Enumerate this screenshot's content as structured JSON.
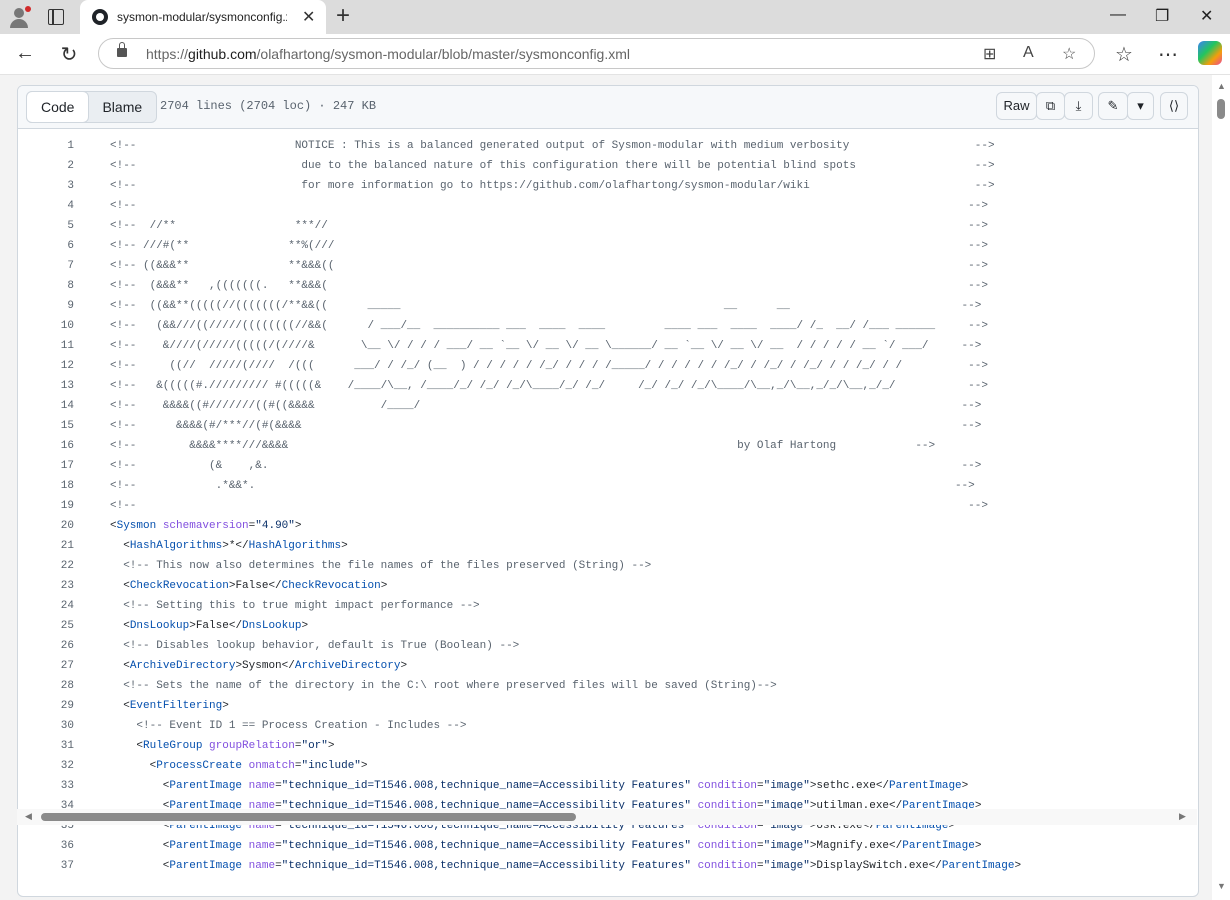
{
  "browser": {
    "tab_title": "sysmon-modular/sysmonconfig.xml",
    "url_prefix": "https://",
    "url_host": "github.com",
    "url_path": "/olafhartong/sysmon-modular/blob/master/sysmonconfig.xml"
  },
  "toolbar": {
    "code_label": "Code",
    "blame_label": "Blame",
    "file_info": "2704 lines (2704 loc) · 247 KB",
    "raw_label": "Raw"
  },
  "code_lines": [
    {
      "n": "1",
      "t": "<!--                        NOTICE : This is a balanced generated output of Sysmon-modular with medium verbosity                   -->"
    },
    {
      "n": "2",
      "t": "<!--                         due to the balanced nature of this configuration there will be potential blind spots                  -->"
    },
    {
      "n": "3",
      "t": "<!--                         for more information go to https://github.com/olafhartong/sysmon-modular/wiki                         -->"
    },
    {
      "n": "4",
      "t": "<!--                                                                                                                              -->"
    },
    {
      "n": "5",
      "t": "<!--  //**                  ***//                                                                                                 -->"
    },
    {
      "n": "6",
      "t": "<!-- ///#(**               **%(///                                                                                                -->"
    },
    {
      "n": "7",
      "t": "<!-- ((&&&**               **&&&((                                                                                                -->"
    },
    {
      "n": "8",
      "t": "<!--  (&&&**   ,(((((((.   **&&&(                                                                                                 -->"
    },
    {
      "n": "9",
      "t": "<!--  ((&&**(((((//(((((((/**&&((      _____                                                 __      __                          -->"
    },
    {
      "n": "10",
      "t": "<!--   (&&///((/////((((((((//&&(      / ___/__  __________ ___  ____  ____         ____ ___  ____  ____/ /_  __/ /___ ______     -->"
    },
    {
      "n": "11",
      "t": "<!--    &////(/////(((((/(////&       \\__ \\/ / / / ___/ __ `__ \\/ __ \\/ __ \\______/ __ `__ \\/ __ \\/ __  / / / / / __ `/ ___/     -->"
    },
    {
      "n": "12",
      "t": "<!--     ((//  /////(////  /(((      ___/ / /_/ (__  ) / / / / / /_/ / / / /_____/ / / / / / /_/ / /_/ / /_/ / / /_/ / /          -->"
    },
    {
      "n": "13",
      "t": "<!--   &(((((#.///////// #(((((&    /____/\\__, /____/_/ /_/ /_/\\____/_/ /_/     /_/ /_/ /_/\\____/\\__,_/\\__,_/_/\\__,_/_/           -->"
    },
    {
      "n": "14",
      "t": "<!--    &&&&((#///////((#((&&&&          /____/                                                                                  -->"
    },
    {
      "n": "15",
      "t": "<!--      &&&&(#/***//(#(&&&&                                                                                                    -->"
    },
    {
      "n": "16",
      "t": "<!--        &&&&****///&&&&                                                                    by Olaf Hartong            -->"
    },
    {
      "n": "17",
      "t": "<!--           (&    ,&.                                                                                                         -->"
    },
    {
      "n": "18",
      "t": "<!--            .*&&*.                                                                                                          -->"
    },
    {
      "n": "19",
      "t": "<!--                                                                                                                              -->"
    },
    {
      "n": "20",
      "t": "<Sysmon schemaversion=\"4.90\">"
    },
    {
      "n": "21",
      "t": "  <HashAlgorithms>*</HashAlgorithms>"
    },
    {
      "n": "22",
      "t": "  <!-- This now also determines the file names of the files preserved (String) -->"
    },
    {
      "n": "23",
      "t": "  <CheckRevocation>False</CheckRevocation>"
    },
    {
      "n": "24",
      "t": "  <!-- Setting this to true might impact performance -->"
    },
    {
      "n": "25",
      "t": "  <DnsLookup>False</DnsLookup>"
    },
    {
      "n": "26",
      "t": "  <!-- Disables lookup behavior, default is True (Boolean) -->"
    },
    {
      "n": "27",
      "t": "  <ArchiveDirectory>Sysmon</ArchiveDirectory>"
    },
    {
      "n": "28",
      "t": "  <!-- Sets the name of the directory in the C:\\ root where preserved files will be saved (String)-->"
    },
    {
      "n": "29",
      "t": "  <EventFiltering>"
    },
    {
      "n": "30",
      "t": "    <!-- Event ID 1 == Process Creation - Includes -->"
    },
    {
      "n": "31",
      "t": "    <RuleGroup groupRelation=\"or\">"
    },
    {
      "n": "32",
      "t": "      <ProcessCreate onmatch=\"include\">"
    },
    {
      "n": "33",
      "t": "        <ParentImage name=\"technique_id=T1546.008,technique_name=Accessibility Features\" condition=\"image\">sethc.exe</ParentImage>"
    },
    {
      "n": "34",
      "t": "        <ParentImage name=\"technique_id=T1546.008,technique_name=Accessibility Features\" condition=\"image\">utilman.exe</ParentImage>"
    },
    {
      "n": "35",
      "t": "        <ParentImage name=\"technique_id=T1546.008,technique_name=Accessibility Features\" condition=\"image\">osk.exe</ParentImage>"
    },
    {
      "n": "36",
      "t": "        <ParentImage name=\"technique_id=T1546.008,technique_name=Accessibility Features\" condition=\"image\">Magnify.exe</ParentImage>"
    },
    {
      "n": "37",
      "t": "        <ParentImage name=\"technique_id=T1546.008,technique_name=Accessibility Features\" condition=\"image\">DisplaySwitch.exe</ParentImage>"
    }
  ]
}
